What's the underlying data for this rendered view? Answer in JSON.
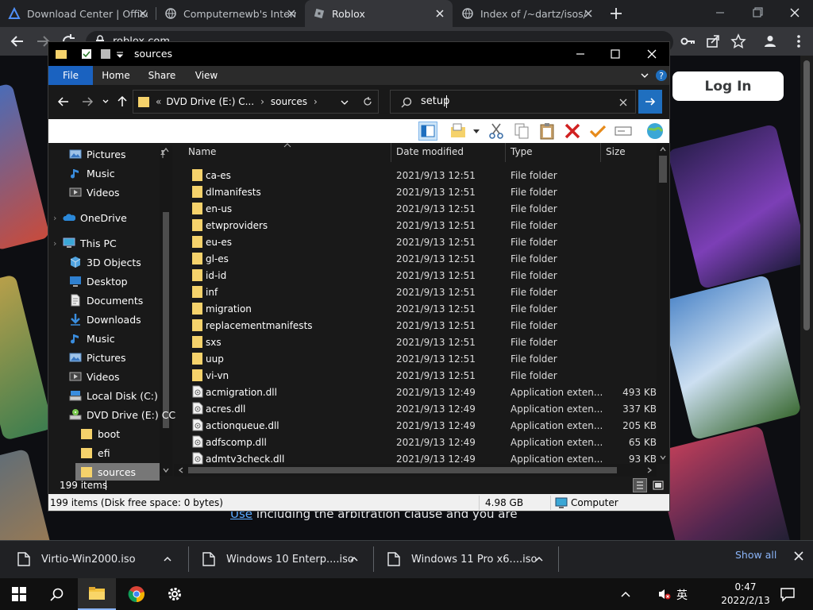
{
  "chrome": {
    "tabs": [
      {
        "title": "Download Center | Office",
        "active": false
      },
      {
        "title": "Computernewb's Internet",
        "active": false
      },
      {
        "title": "Roblox",
        "active": true
      },
      {
        "title": "Index of /~dartz/isos/",
        "active": false
      }
    ],
    "url": "roblox.com"
  },
  "page": {
    "login_label": "Log In",
    "legal_link": "Use",
    "legal_text": "including the arbitration clause and you are"
  },
  "explorer": {
    "title": "sources",
    "ribbon_tabs": [
      "File",
      "Home",
      "Share",
      "View"
    ],
    "address": {
      "root": "«",
      "drive": "DVD Drive (E:) C...",
      "folder": "sources"
    },
    "search": {
      "value": "setup"
    },
    "nav": [
      {
        "label": "Pictures",
        "icon": "pictures-icon",
        "pinned": true
      },
      {
        "label": "Music",
        "icon": "music-icon"
      },
      {
        "label": "Videos",
        "icon": "videos-icon"
      },
      {
        "label": "OneDrive",
        "icon": "onedrive-icon"
      },
      {
        "label": "This PC",
        "icon": "this-pc-icon"
      },
      {
        "label": "3D Objects",
        "icon": "3d-objects-icon"
      },
      {
        "label": "Desktop",
        "icon": "desktop-icon"
      },
      {
        "label": "Documents",
        "icon": "documents-icon"
      },
      {
        "label": "Downloads",
        "icon": "downloads-icon"
      },
      {
        "label": "Music",
        "icon": "music-icon"
      },
      {
        "label": "Pictures",
        "icon": "pictures-icon"
      },
      {
        "label": "Videos",
        "icon": "videos-icon"
      },
      {
        "label": "Local Disk (C:)",
        "icon": "local-disk-icon"
      },
      {
        "label": "DVD Drive (E:) CC",
        "icon": "dvd-drive-icon"
      },
      {
        "label": "boot",
        "icon": "folder-icon"
      },
      {
        "label": "efi",
        "icon": "folder-icon"
      },
      {
        "label": "sources",
        "icon": "folder-icon",
        "selected": true
      }
    ],
    "columns": {
      "name": "Name",
      "date": "Date modified",
      "type": "Type",
      "size": "Size"
    },
    "files": [
      {
        "name": "ca-es",
        "date": "2021/9/13 12:51",
        "type": "File folder",
        "size": "",
        "kind": "folder"
      },
      {
        "name": "dlmanifests",
        "date": "2021/9/13 12:51",
        "type": "File folder",
        "size": "",
        "kind": "folder"
      },
      {
        "name": "en-us",
        "date": "2021/9/13 12:51",
        "type": "File folder",
        "size": "",
        "kind": "folder"
      },
      {
        "name": "etwproviders",
        "date": "2021/9/13 12:51",
        "type": "File folder",
        "size": "",
        "kind": "folder"
      },
      {
        "name": "eu-es",
        "date": "2021/9/13 12:51",
        "type": "File folder",
        "size": "",
        "kind": "folder"
      },
      {
        "name": "gl-es",
        "date": "2021/9/13 12:51",
        "type": "File folder",
        "size": "",
        "kind": "folder"
      },
      {
        "name": "id-id",
        "date": "2021/9/13 12:51",
        "type": "File folder",
        "size": "",
        "kind": "folder"
      },
      {
        "name": "inf",
        "date": "2021/9/13 12:51",
        "type": "File folder",
        "size": "",
        "kind": "folder"
      },
      {
        "name": "migration",
        "date": "2021/9/13 12:51",
        "type": "File folder",
        "size": "",
        "kind": "folder"
      },
      {
        "name": "replacementmanifests",
        "date": "2021/9/13 12:51",
        "type": "File folder",
        "size": "",
        "kind": "folder"
      },
      {
        "name": "sxs",
        "date": "2021/9/13 12:51",
        "type": "File folder",
        "size": "",
        "kind": "folder"
      },
      {
        "name": "uup",
        "date": "2021/9/13 12:51",
        "type": "File folder",
        "size": "",
        "kind": "folder"
      },
      {
        "name": "vi-vn",
        "date": "2021/9/13 12:51",
        "type": "File folder",
        "size": "",
        "kind": "folder"
      },
      {
        "name": "acmigration.dll",
        "date": "2021/9/13 12:49",
        "type": "Application exten...",
        "size": "493 KB",
        "kind": "dll"
      },
      {
        "name": "acres.dll",
        "date": "2021/9/13 12:49",
        "type": "Application exten...",
        "size": "337 KB",
        "kind": "dll"
      },
      {
        "name": "actionqueue.dll",
        "date": "2021/9/13 12:49",
        "type": "Application exten...",
        "size": "205 KB",
        "kind": "dll"
      },
      {
        "name": "adfscomp.dll",
        "date": "2021/9/13 12:49",
        "type": "Application exten...",
        "size": "65 KB",
        "kind": "dll"
      },
      {
        "name": "admtv3check.dll",
        "date": "2021/9/13 12:49",
        "type": "Application exten...",
        "size": "93 KB",
        "kind": "dll"
      }
    ],
    "item_count": "199 items",
    "status_left": "199 items (Disk free space: 0 bytes)",
    "status_size": "4.98 GB",
    "status_location": "Computer"
  },
  "downloads": {
    "items": [
      "Virtio-Win2000.iso",
      "Windows 10 Enterp....iso",
      "Windows 11 Pro x6....iso"
    ],
    "show_all": "Show all"
  },
  "taskbar": {
    "ime": "英",
    "time": "0:47",
    "date": "2022/2/13"
  },
  "colors": {
    "accent": "#1f6fbf",
    "folder": "#f5d26b",
    "link": "#5aa9ff"
  }
}
